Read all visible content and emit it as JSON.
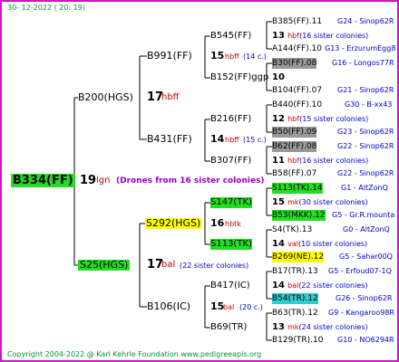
{
  "date": "30-  12-2022  ( 20:  19)",
  "copyright": "Copyright 2004-2022 @ Karl Kehrle Foundation    www.pedigreeapis.org",
  "root": {
    "label": "B334(FF)",
    "num": "19",
    "breed": "lgn",
    "note": "(Drones from 16 sister colonies)"
  },
  "g1": [
    {
      "label": "B200(HGS)",
      "num": "17",
      "breed": "hbff"
    },
    {
      "label": "S25(HGS)",
      "num": "17",
      "breed": "bal",
      "note": "(22 sister colonies)"
    }
  ],
  "g2": [
    {
      "label": "B991(FF)",
      "num": "15",
      "breed": "hbff",
      "note": "(14 c.)"
    },
    {
      "label": "B431(FF)",
      "num": "14",
      "breed": "hbff",
      "note": "(15 c.)"
    },
    {
      "label": "S292(HGS)",
      "num": "16",
      "breed": "hbtk"
    },
    {
      "label": "B106(IC)",
      "num": "15",
      "breed": "bal",
      "note": "(20 c.)"
    }
  ],
  "g3": [
    {
      "label": "B545(FF)",
      "num": "13",
      "breed": "hbf",
      "note": "(16 sister colonies)"
    },
    {
      "label": "B152(FF)ggp",
      "num": "10"
    },
    {
      "label": "B216(FF)",
      "num": "12",
      "breed": "hbf",
      "note": "(15 sister colonies)"
    },
    {
      "label": "B307(FF)",
      "num": "11",
      "breed": "hbf",
      "note": "(16 sister colonies)"
    },
    {
      "label": "S147(TK)",
      "num": "15",
      "breed": "mk",
      "note": "(30 sister colonies)"
    },
    {
      "label": "S113(TK)",
      "num": "14",
      "breed": "val",
      "note": "(10 sister colonies)"
    },
    {
      "label": "B417(IC)",
      "num": "14",
      "breed": "bal",
      "note": "(22 sister colonies)"
    },
    {
      "label": "B69(TR)",
      "num": "13",
      "breed": "mk",
      "note": "(24 sister colonies)"
    }
  ],
  "g4": [
    {
      "label": "B385(FF).11",
      "ref": "G24 - Sinop62R"
    },
    {
      "label": "A144(FF).10",
      "ref": "G13 - ErzurumEgg8"
    },
    {
      "label": "B30(FF).08",
      "ref": "G16 - Longos77R"
    },
    {
      "label": "B104(FF).07",
      "ref": "G21 - Sinop62R"
    },
    {
      "label": "B440(FF).10",
      "ref": "G30 - B-xx43"
    },
    {
      "label": "B50(FF).09",
      "ref": "G23 - Sinop62R"
    },
    {
      "label": "B62(FF).08",
      "ref": "G22 - Sinop62R"
    },
    {
      "label": "B58(FF).07",
      "ref": "G22 - Sinop62R"
    },
    {
      "label": "S113(TK).14",
      "ref": "G1 - AltZonQ"
    },
    {
      "label": "B53(MKK).12",
      "ref": "G5 - Gr.R.mounta"
    },
    {
      "label": "S4(TK).13",
      "ref": "G0 - AltZonQ"
    },
    {
      "label": "B269(NE).12",
      "ref": "G5 - Sahar00Q"
    },
    {
      "label": "B17(TR).13",
      "ref": "G5 - Erfoud07-1Q"
    },
    {
      "label": "B54(TR).12",
      "ref": "G26 - Sinop62R"
    },
    {
      "label": "B63(TR).12",
      "ref": "G9 - Kangaroo98R"
    },
    {
      "label": "B129(TR).10",
      "ref": "G10 - NO6294R"
    }
  ]
}
